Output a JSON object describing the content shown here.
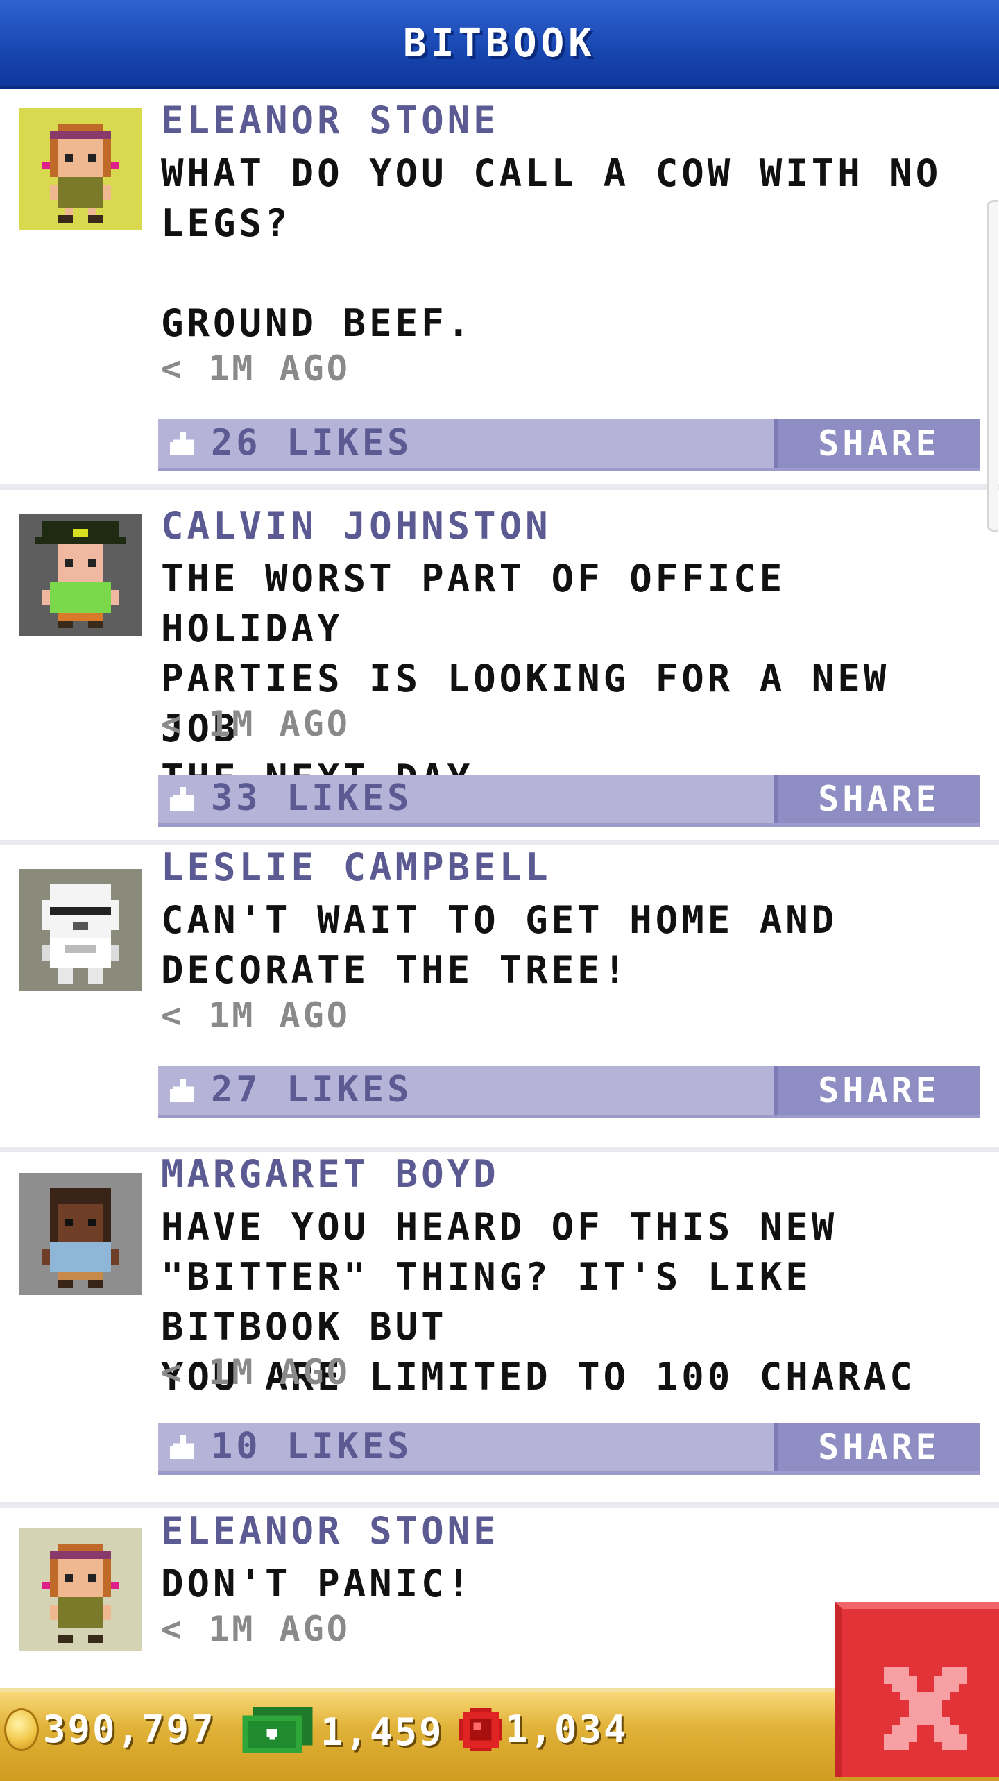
{
  "header": {
    "title": "BITBOOK"
  },
  "posts": [
    {
      "author": "ELEANOR STONE",
      "avatar": "eleanor-stone-avatar",
      "avatar_bg": "#d8d94f",
      "message": "WHAT DO YOU CALL A COW WITH NO\nLEGS?\n\nGROUND BEEF.",
      "time": "< 1M AGO",
      "likes": "26 LIKES",
      "share_label": "SHARE"
    },
    {
      "author": "CALVIN JOHNSTON",
      "avatar": "calvin-johnston-avatar",
      "avatar_bg": "#5e5e5e",
      "message": "THE WORST PART OF OFFICE HOLIDAY\nPARTIES IS LOOKING FOR A NEW JOB\nTHE NEXT DAY.",
      "time": "< 1M AGO",
      "likes": "33 LIKES",
      "share_label": "SHARE"
    },
    {
      "author": "LESLIE CAMPBELL",
      "avatar": "leslie-campbell-avatar",
      "avatar_bg": "#8b8b7b",
      "message": "CAN'T WAIT TO GET HOME AND\nDECORATE THE TREE!",
      "time": "< 1M AGO",
      "likes": "27 LIKES",
      "share_label": "SHARE"
    },
    {
      "author": "MARGARET BOYD",
      "avatar": "margaret-boyd-avatar",
      "avatar_bg": "#8e8e8e",
      "message": "HAVE YOU HEARD OF THIS NEW\n\"BITTER\" THING? IT'S LIKE BITBOOK BUT\nYOU ARE LIMITED TO 100 CHARAC",
      "time": "< 1M AGO",
      "likes": "10 LIKES",
      "share_label": "SHARE"
    },
    {
      "author": "ELEANOR STONE",
      "avatar": "eleanor-stone-avatar",
      "avatar_bg": "#d4d4b4",
      "message": "DON'T PANIC!",
      "time": "< 1M AGO"
    }
  ],
  "bottom_bar": {
    "coins": "390,797",
    "cash": "1,459",
    "gems": "1,034"
  },
  "colors": {
    "header_blue": "#1746b0",
    "author_purple": "#5b5a92",
    "like_bar": "#b5b4d8",
    "share_button": "#8f8ec4",
    "close_red": "#e23338",
    "bottom_gold": "#e0b238"
  },
  "icons": [
    "like-icon",
    "coin-icon",
    "cash-icon",
    "gem-icon",
    "close-icon"
  ]
}
